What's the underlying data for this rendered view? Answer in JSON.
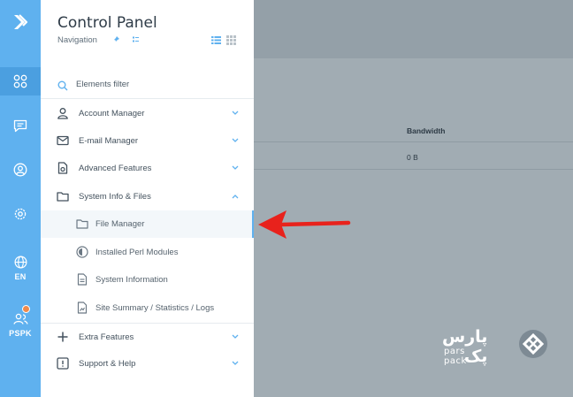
{
  "header": {
    "title": "Control Panel",
    "subtitle": "Navigation"
  },
  "rail": {
    "items": [
      {
        "icon": "grid-icon"
      },
      {
        "icon": "chat-icon"
      },
      {
        "icon": "user-circle-icon"
      },
      {
        "icon": "gear-icon"
      },
      {
        "icon": "globe-icon",
        "label": "EN"
      },
      {
        "icon": "user-group-icon",
        "label": "PSPK"
      }
    ]
  },
  "search": {
    "placeholder": "Elements filter"
  },
  "menu": [
    {
      "label": "Account Manager",
      "icon": "user-icon",
      "expanded": false
    },
    {
      "label": "E-mail Manager",
      "icon": "mail-icon",
      "expanded": false
    },
    {
      "label": "Advanced Features",
      "icon": "document-gear-icon",
      "expanded": false
    },
    {
      "label": "System Info & Files",
      "icon": "folder-icon",
      "expanded": true
    },
    {
      "label": "Extra Features",
      "icon": "plus-icon",
      "expanded": false
    },
    {
      "label": "Support & Help",
      "icon": "alert-icon",
      "expanded": false
    }
  ],
  "submenu": [
    {
      "label": "File Manager",
      "icon": "folder-outline-icon",
      "active": true
    },
    {
      "label": "Installed Perl Modules",
      "icon": "perl-icon",
      "active": false
    },
    {
      "label": "System Information",
      "icon": "document-icon",
      "active": false
    },
    {
      "label": "Site Summary / Statistics / Logs",
      "icon": "chart-doc-icon",
      "active": false
    }
  ],
  "main": {
    "table_header": "Bandwidth",
    "table_value": "0 B"
  },
  "watermark": {
    "name_fa": "پارس پک",
    "name_en": "pars pack"
  },
  "colors": {
    "rail": "#5fb1ef",
    "accent": "#5fb1ef",
    "arrow": "#e8221c",
    "overlay": "#9aa6ae"
  }
}
